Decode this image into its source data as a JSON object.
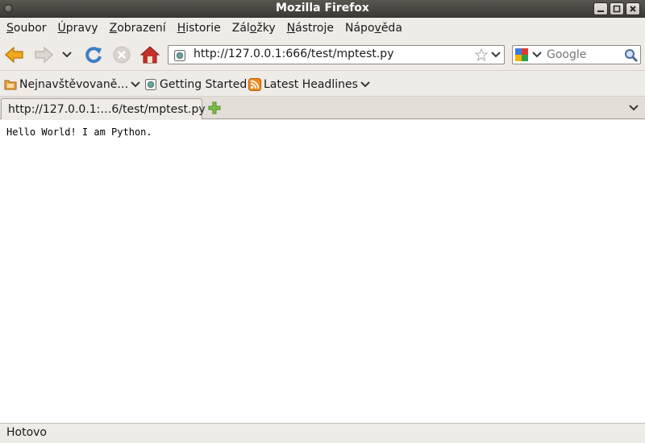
{
  "window": {
    "title": "Mozilla Firefox"
  },
  "menu": [
    {
      "pre": "",
      "key": "S",
      "post": "oubor"
    },
    {
      "pre": "",
      "key": "Ú",
      "post": "pravy"
    },
    {
      "pre": "",
      "key": "Z",
      "post": "obrazení"
    },
    {
      "pre": "",
      "key": "H",
      "post": "istorie"
    },
    {
      "pre": "Zál",
      "key": "o",
      "post": "žky"
    },
    {
      "pre": "",
      "key": "N",
      "post": "ástroje"
    },
    {
      "pre": "Nápo",
      "key": "v",
      "post": "ěda"
    }
  ],
  "address": {
    "url": "http://127.0.0.1:666/test/mptest.py"
  },
  "search": {
    "placeholder": "Google"
  },
  "bookmarks": [
    {
      "label": "Nejnavštěvovaně…",
      "icon": "folder-icon"
    },
    {
      "label": "Getting Started",
      "icon": "page-icon"
    },
    {
      "label": "Latest Headlines",
      "icon": "rss-icon"
    }
  ],
  "tabs": [
    {
      "label": "http://127.0.0.1:…6/test/mptest.py"
    }
  ],
  "page": {
    "text": "Hello World! I am Python."
  },
  "status": {
    "text": "Hotovo"
  },
  "colors": {
    "home": "#c4312b",
    "reload": "#3c7fc8",
    "back": "#f0a81c",
    "newtab": "#7cc04a"
  }
}
